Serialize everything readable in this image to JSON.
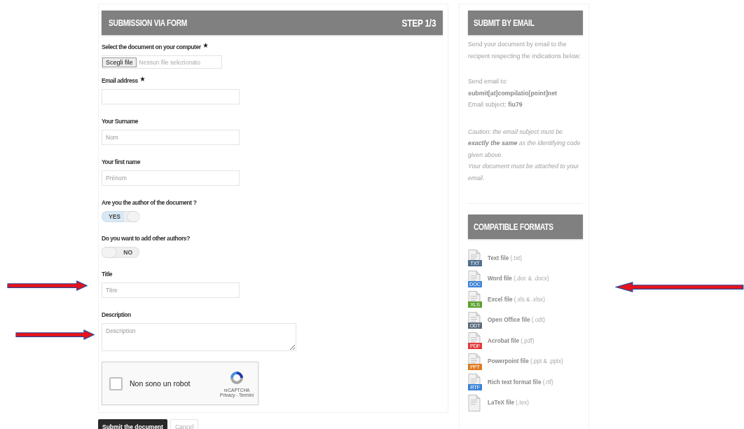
{
  "form": {
    "title": "SUBMISSION VIA FORM",
    "step": "STEP 1/3",
    "fields": [
      {
        "kind": "file",
        "label": "Select the document on your computer",
        "required": true,
        "button": "Scegli file",
        "value": "Nessun file selezionato"
      },
      {
        "kind": "text",
        "label": "Email address",
        "required": true
      },
      {
        "kind": "text",
        "label": "Your Surname",
        "required": false,
        "placeholder": "Nom"
      },
      {
        "kind": "text",
        "label": "Your first name",
        "required": false,
        "placeholder": "Prénom"
      },
      {
        "kind": "toggle",
        "label": "Are you the author of the document ?",
        "required": false,
        "text": "YES",
        "on": true
      },
      {
        "kind": "toggle",
        "label": "Do you want to add other authors?",
        "required": false,
        "text": "NO",
        "on": false
      },
      {
        "kind": "text",
        "label": "Title",
        "required": false,
        "placeholder": "Titre"
      },
      {
        "kind": "textarea",
        "label": "Description",
        "required": false,
        "placeholder": "Description"
      }
    ],
    "captcha": {
      "label": "Non sono un robot",
      "checked": false,
      "brand": "reCAPTCHA",
      "links": "Privacy - Termini"
    },
    "buttons": [
      {
        "label": "Submit the document",
        "kind": "primary"
      },
      {
        "label": "Cancel",
        "kind": "secondary"
      }
    ]
  },
  "email": {
    "title": "SUBMIT BY EMAIL",
    "intro": "Send your document by email to the recipent respecting the indications below:",
    "send_to_label": "Send email to:",
    "address": "submit[at]compilatio[point]net",
    "subject": "Email subject: **fiu79**",
    "caution": [
      "Caution: the email subject must be **exactly the same** as the identifying code given above.",
      "Your document must be attached to your email."
    ]
  },
  "formats": {
    "title": "COMPATIBLE FORMATS",
    "items": [
      {
        "badge": "TXT",
        "color": "#4f6f8f",
        "text": "**Text file** (.txt)"
      },
      {
        "badge": "DOC",
        "color": "#3b82d6",
        "text": "**Word file** (.doc & .docx)"
      },
      {
        "badge": "XLS",
        "color": "#5aa02c",
        "text": "**Excel file** (.xls & .xlsx)"
      },
      {
        "badge": "ODT",
        "color": "#5b6b7b",
        "text": "**Open Office file** (.odt)"
      },
      {
        "badge": "PDF",
        "color": "#e33a3a",
        "text": "**Acrobat file** (.pdf)"
      },
      {
        "badge": "PPT",
        "color": "#e07a22",
        "text": "**Powerpoint file** (.ppt & .pptx)"
      },
      {
        "badge": "RTF",
        "color": "#3b82d6",
        "text": "**Rich text format file** (.rtf)"
      },
      {
        "text": "**LaTeX file** (.tex)"
      }
    ]
  },
  "annotations": [
    {
      "kind": "right"
    },
    {
      "kind": "right"
    },
    {
      "kind": "left"
    }
  ]
}
